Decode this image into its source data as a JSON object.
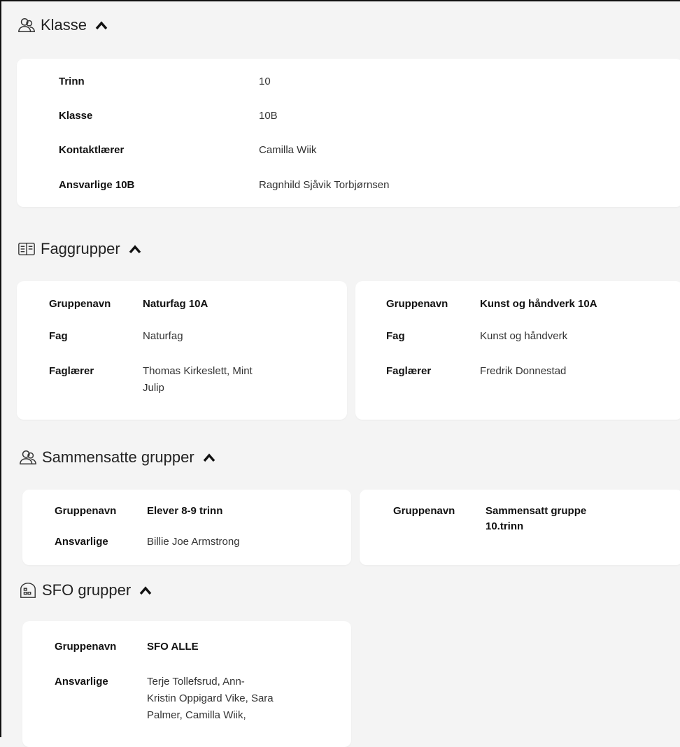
{
  "klasse": {
    "title": "Klasse",
    "rows": [
      {
        "label": "Trinn",
        "value": "10"
      },
      {
        "label": "Klasse",
        "value": "10B"
      },
      {
        "label": "Kontaktlærer",
        "value": "Camilla Wiik"
      },
      {
        "label": "Ansvarlige 10B",
        "value": "Ragnhild Sjåvik Torbjørnsen"
      }
    ]
  },
  "faggrupper": {
    "title": "Faggrupper",
    "cards": [
      {
        "gruppenavn_label": "Gruppenavn",
        "gruppenavn": "Naturfag 10A",
        "fag_label": "Fag",
        "fag": "Naturfag",
        "laerer_label": "Faglærer",
        "laerer_line1": "Thomas Kirkeslett, Mint",
        "laerer_line2": "Julip"
      },
      {
        "gruppenavn_label": "Gruppenavn",
        "gruppenavn": "Kunst og håndverk 10A",
        "fag_label": "Fag",
        "fag": "Kunst og håndverk",
        "laerer_label": "Faglærer",
        "laerer_line1": "Fredrik Donnestad"
      }
    ]
  },
  "sammensatte": {
    "title": "Sammensatte grupper",
    "cards": [
      {
        "gruppenavn_label": "Gruppenavn",
        "gruppenavn": "Elever 8-9 trinn",
        "ansvarlige_label": "Ansvarlige",
        "ansvarlige": "Billie Joe Armstrong"
      },
      {
        "gruppenavn_label": "Gruppenavn",
        "gruppenavn_line1": "Sammensatt gruppe",
        "gruppenavn_line2": "10.trinn"
      }
    ]
  },
  "sfo": {
    "title": "SFO grupper",
    "cards": [
      {
        "gruppenavn_label": "Gruppenavn",
        "gruppenavn": "SFO ALLE",
        "ansvarlige_label": "Ansvarlige",
        "ansvarlige_line1": "Terje Tollefsrud, Ann-",
        "ansvarlige_line2": "Kristin Oppigard Vike, Sara",
        "ansvarlige_line3": "Palmer, Camilla Wiik,"
      }
    ]
  },
  "icons": {
    "klasse": "people-icon",
    "faggrupper": "book-icon",
    "sammensatte": "people-icon",
    "sfo": "house-icon",
    "collapse": "chevron-up-icon"
  }
}
